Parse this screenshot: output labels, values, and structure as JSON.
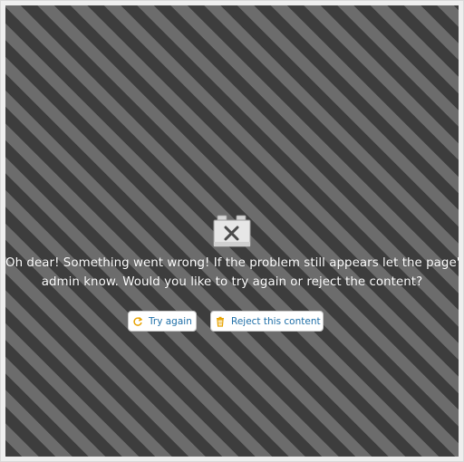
{
  "error": {
    "icon": "broken-block-icon",
    "message_line1": "Oh dear! Something went wrong! If the problem still appears let the page's",
    "message_line2": "admin know. Would you like to try again or reject the content?"
  },
  "actions": {
    "try_again": {
      "label": "Try again",
      "icon": "refresh-icon",
      "icon_color": "#e8a300"
    },
    "reject": {
      "label": "Reject this content",
      "icon": "trash-icon",
      "icon_color": "#e8a300"
    }
  },
  "colors": {
    "stripe_dark": "#3d3d3d",
    "stripe_light": "#6c6c6c",
    "link_text": "#1f6fa8"
  }
}
